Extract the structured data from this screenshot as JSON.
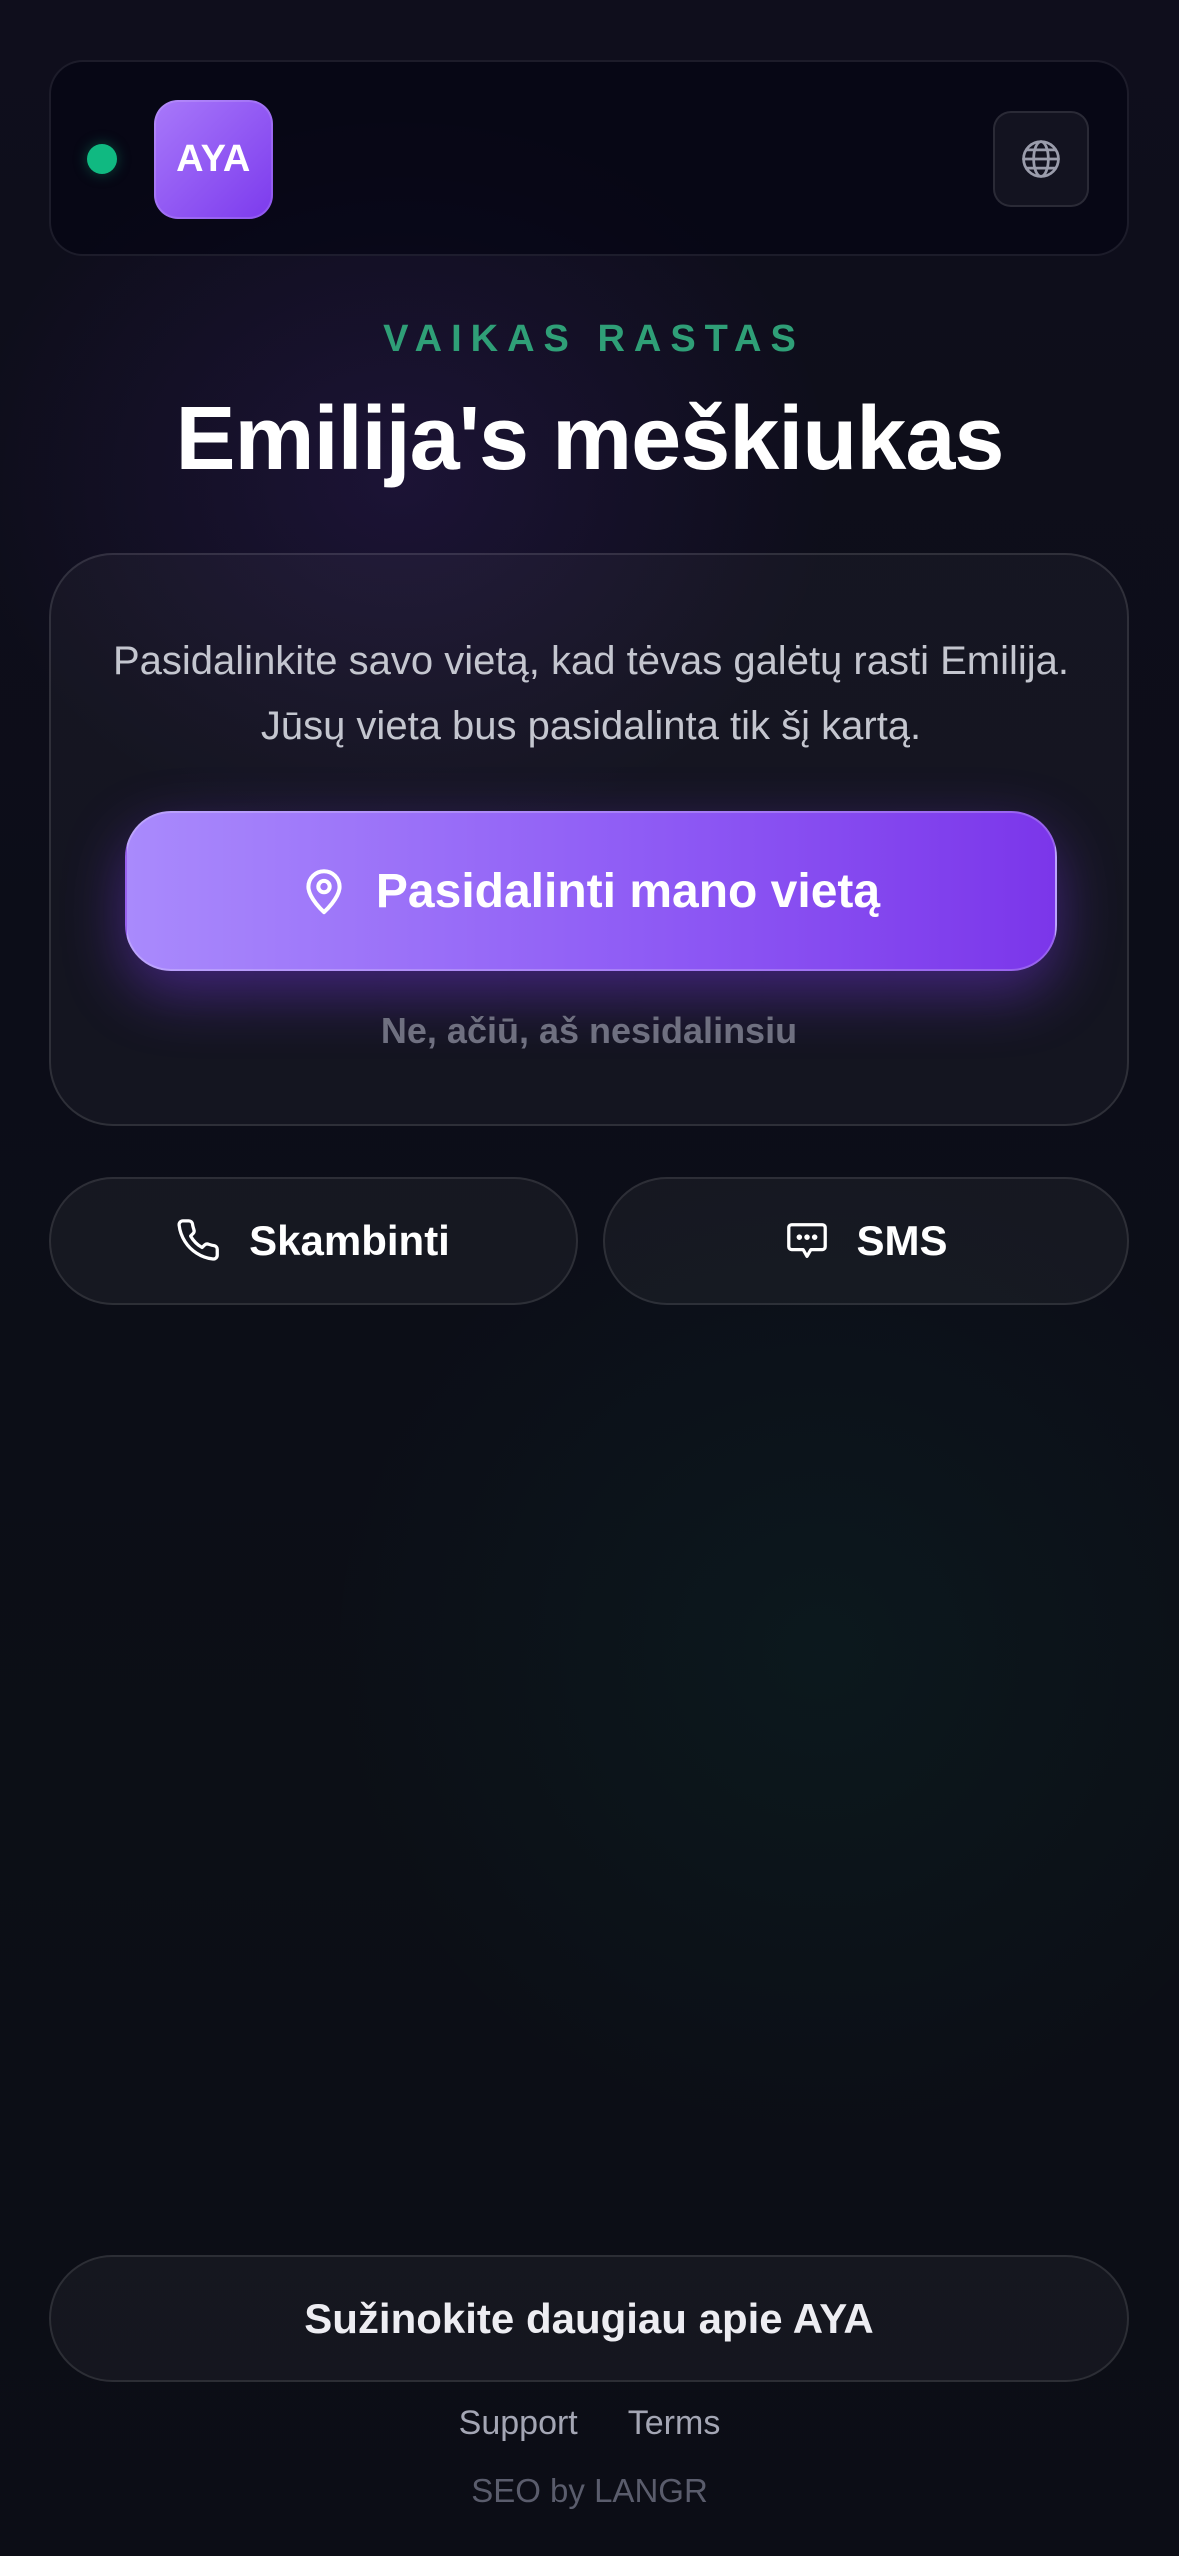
{
  "header": {
    "logo_text": "AYA",
    "status_color": "#10b981",
    "language_icon": "globe-icon"
  },
  "hero": {
    "eyebrow": "VAIKAS RASTAS",
    "title": "Emilija's meškiukas"
  },
  "share_card": {
    "description": "Pasidalinkite savo vietą, kad tėvas galėtų rasti Emilija. Jūsų vieta bus pasidalinta tik šį kartą.",
    "share_button_label": "Pasidalinti mano vietą",
    "share_button_icon": "map-pin-icon",
    "decline_label": "Ne, ačiū, aš nesidalinsiu"
  },
  "contact": {
    "call_label": "Skambinti",
    "call_icon": "phone-icon",
    "sms_label": "SMS",
    "sms_icon": "message-icon"
  },
  "footer": {
    "learn_more_label": "Sužinokite daugiau apie AYA",
    "support_label": "Support",
    "terms_label": "Terms",
    "credit": "SEO by LANGR"
  },
  "colors": {
    "accent": "#8b5cf6",
    "accent_dark": "#7c3aed",
    "success": "#2f9f77",
    "background": "#0c0d18"
  }
}
